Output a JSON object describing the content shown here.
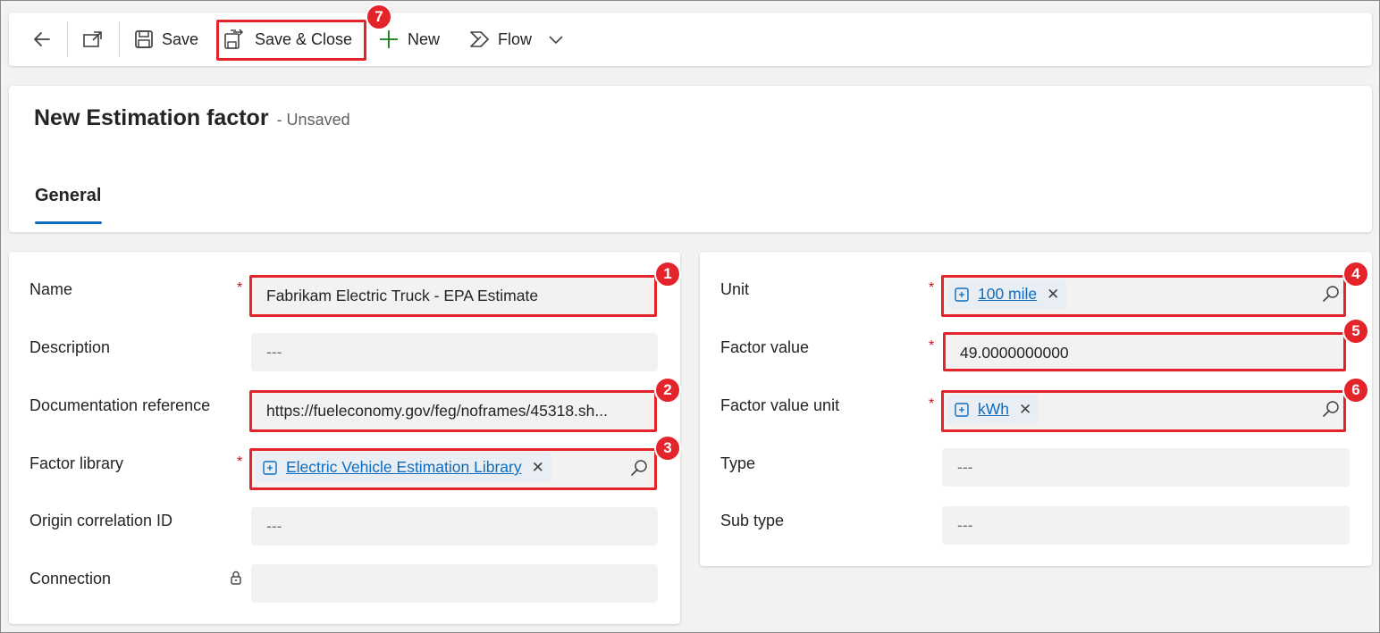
{
  "toolbar": {
    "save_label": "Save",
    "save_close_label": "Save & Close",
    "new_label": "New",
    "flow_label": "Flow"
  },
  "header": {
    "title": "New Estimation factor",
    "status": "- Unsaved",
    "tab": "General"
  },
  "fields": {
    "name": {
      "label": "Name",
      "value": "Fabrikam Electric Truck - EPA Estimate"
    },
    "description": {
      "label": "Description",
      "value": "---"
    },
    "documentation": {
      "label": "Documentation reference",
      "value": "https://fueleconomy.gov/feg/noframes/45318.sh..."
    },
    "factor_library": {
      "label": "Factor library",
      "value": "Electric Vehicle Estimation Library"
    },
    "origin": {
      "label": "Origin correlation ID",
      "value": "---"
    },
    "connection": {
      "label": "Connection",
      "value": ""
    },
    "unit": {
      "label": "Unit",
      "value": "100 mile"
    },
    "factor_value": {
      "label": "Factor value",
      "value": "49.0000000000"
    },
    "factor_value_unit": {
      "label": "Factor value unit",
      "value": "kWh"
    },
    "type": {
      "label": "Type",
      "value": "---"
    },
    "sub_type": {
      "label": "Sub type",
      "value": "---"
    }
  },
  "required_marker": "*",
  "tag_remove": "✕",
  "callouts": [
    "1",
    "2",
    "3",
    "4",
    "5",
    "6",
    "7"
  ],
  "colors": {
    "accent": "#0f6cbd",
    "highlight": "#e3242b",
    "required": "#c50f1f",
    "new_icon": "#107c10"
  }
}
